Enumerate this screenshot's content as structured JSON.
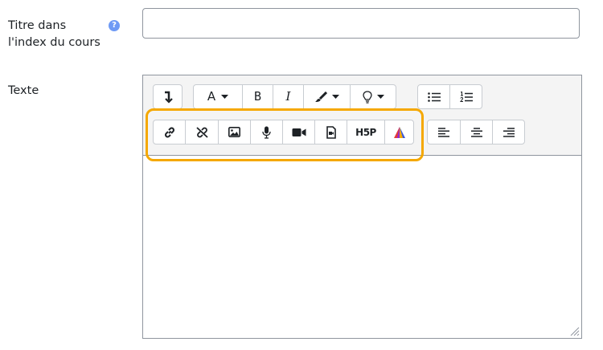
{
  "form": {
    "title_label": "Titre dans l'index du cours",
    "title_value": "",
    "help_glyph": "?",
    "text_label": "Texte"
  },
  "toolbar": {
    "bold_glyph": "B",
    "italic_glyph": "I",
    "font_color_glyph": "A",
    "h5p_label": "H5P"
  },
  "editor": {
    "content": ""
  },
  "colors": {
    "highlight": "#f5a800",
    "h5p_accent": "#1a73d9"
  }
}
